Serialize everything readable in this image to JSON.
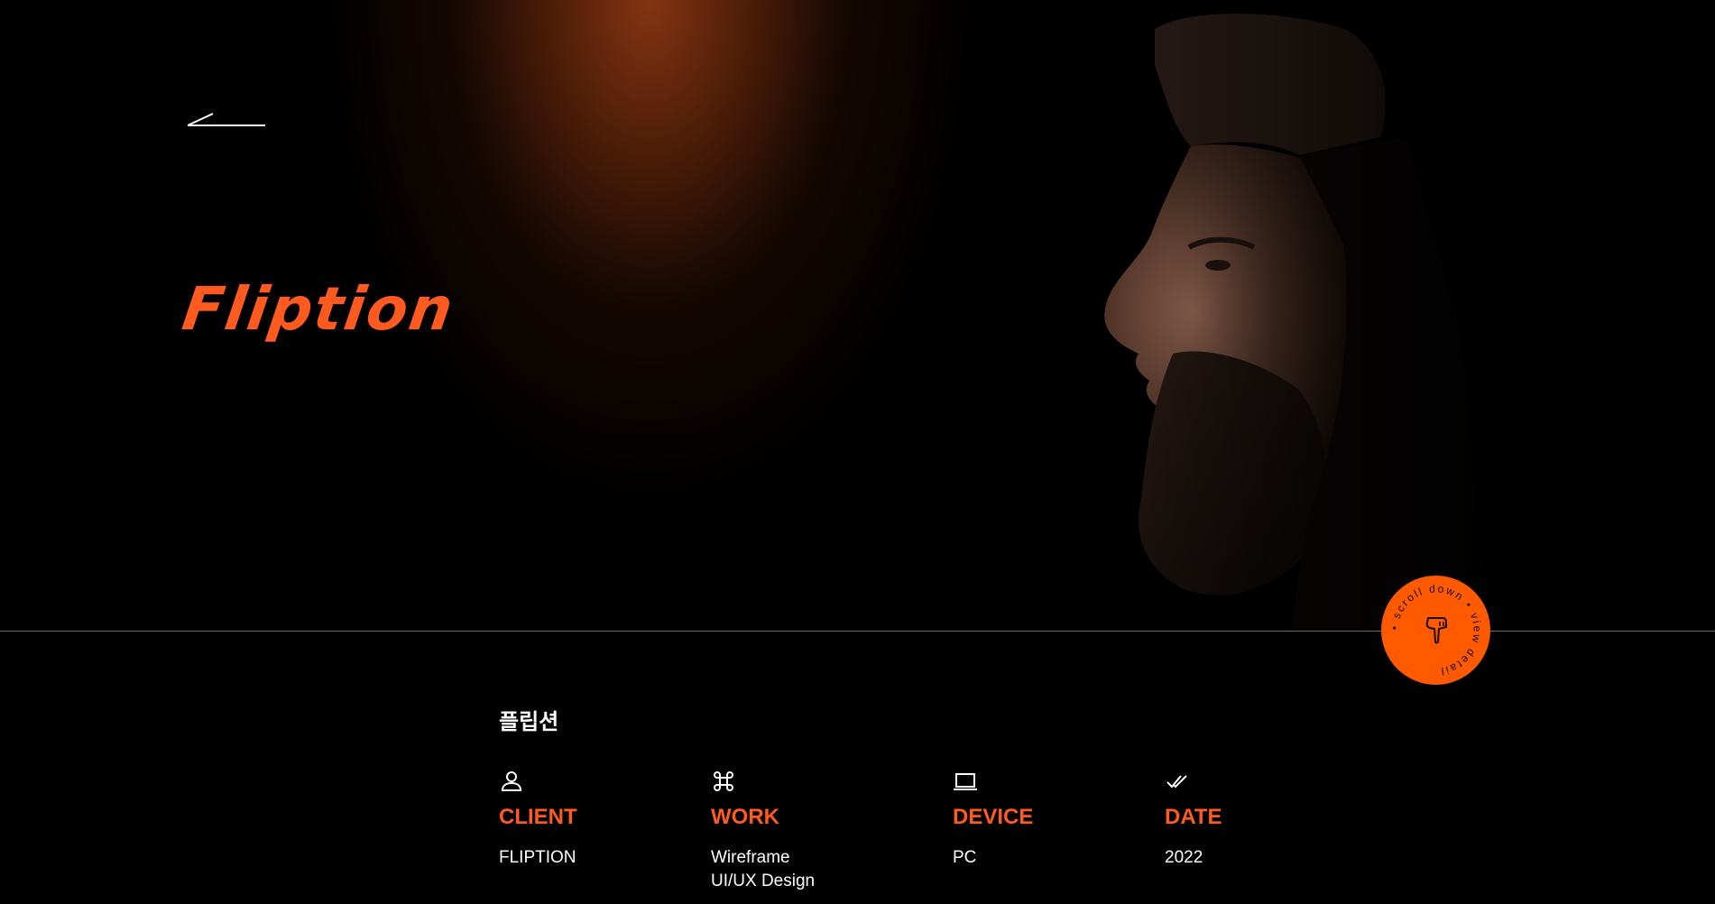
{
  "hero": {
    "brand": "Fliption",
    "back_icon": "back-arrow-icon",
    "accent_color": "#ff5a1f"
  },
  "scroll_badge": {
    "text": "• scroll down • view detail",
    "icon": "pointing-hand-icon",
    "color": "#ff5a00"
  },
  "project": {
    "korean_title": "플립션",
    "info": [
      {
        "icon": "user-icon",
        "label": "CLIENT",
        "values": [
          "FLIPTION"
        ]
      },
      {
        "icon": "command-icon",
        "label": "WORK",
        "values": [
          "Wireframe",
          "UI/UX Design"
        ]
      },
      {
        "icon": "laptop-icon",
        "label": "DEVICE",
        "values": [
          "PC"
        ]
      },
      {
        "icon": "double-check-icon",
        "label": "DATE",
        "values": [
          "2022"
        ]
      }
    ]
  }
}
